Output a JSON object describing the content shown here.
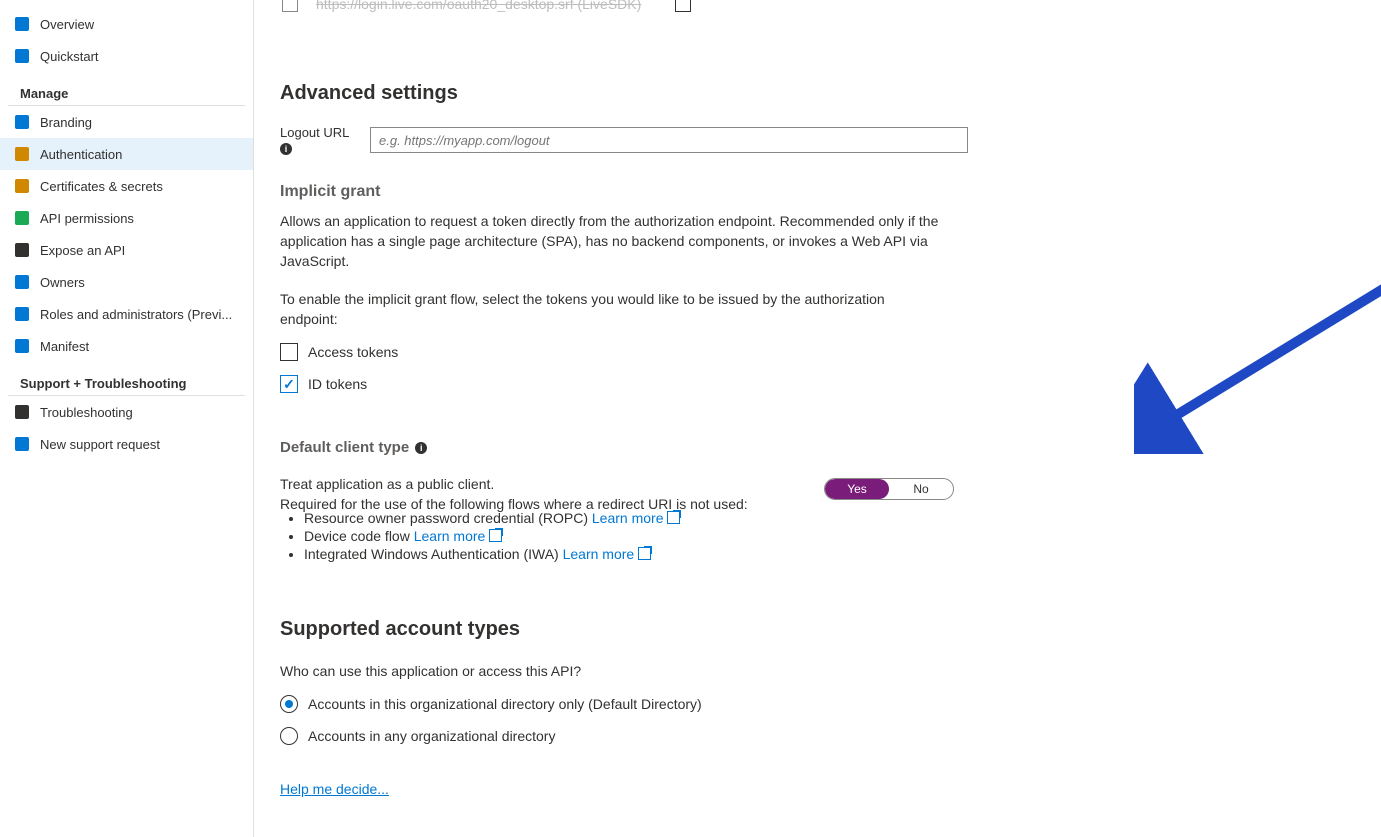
{
  "sidebar": {
    "items": [
      {
        "label": "Overview",
        "icon": "#0078d4"
      },
      {
        "label": "Quickstart",
        "icon": "#0078d4"
      }
    ],
    "group_manage": "Manage",
    "manage_items": [
      {
        "label": "Branding",
        "icon": "#0078d4"
      },
      {
        "label": "Authentication",
        "icon": "#d08800",
        "active": true
      },
      {
        "label": "Certificates & secrets",
        "icon": "#d08800"
      },
      {
        "label": "API permissions",
        "icon": "#1aaa55"
      },
      {
        "label": "Expose an API",
        "icon": "#323130"
      },
      {
        "label": "Owners",
        "icon": "#0078d4"
      },
      {
        "label": "Roles and administrators (Previ...",
        "icon": "#0078d4"
      },
      {
        "label": "Manifest",
        "icon": "#0078d4"
      }
    ],
    "group_support": "Support + Troubleshooting",
    "support_items": [
      {
        "label": "Troubleshooting",
        "icon": "#323130"
      },
      {
        "label": "New support request",
        "icon": "#0078d4"
      }
    ]
  },
  "main": {
    "uri_struck": "https://login.live.com/oauth20_desktop.srf (LiveSDK)",
    "advanced_heading": "Advanced settings",
    "logout_label": "Logout URL",
    "logout_placeholder": "e.g. https://myapp.com/logout",
    "implicit_heading": "Implicit grant",
    "implicit_desc": "Allows an application to request a token directly from the authorization endpoint. Recommended only if the application has a single page architecture (SPA), has no backend components, or invokes a Web API via JavaScript.",
    "implicit_enable": "To enable the implicit grant flow, select the tokens you would like to be issued by the authorization endpoint:",
    "cb_access": "Access tokens",
    "cb_id": "ID tokens",
    "default_client_heading": "Default client type",
    "treat_text": "Treat application as a public client.",
    "required_text": "Required for the use of the following flows where a redirect URI is not used:",
    "flow1": "Resource owner password credential (ROPC) ",
    "flow2": "Device code flow ",
    "flow3": "Integrated Windows Authentication (IWA) ",
    "learn_more": "Learn more",
    "toggle_yes": "Yes",
    "toggle_no": "No",
    "supported_heading": "Supported account types",
    "supported_desc": "Who can use this application or access this API?",
    "radio1": "Accounts in this organizational directory only (Default Directory)",
    "radio2": "Accounts in any organizational directory",
    "help_decide": "Help me decide..."
  }
}
